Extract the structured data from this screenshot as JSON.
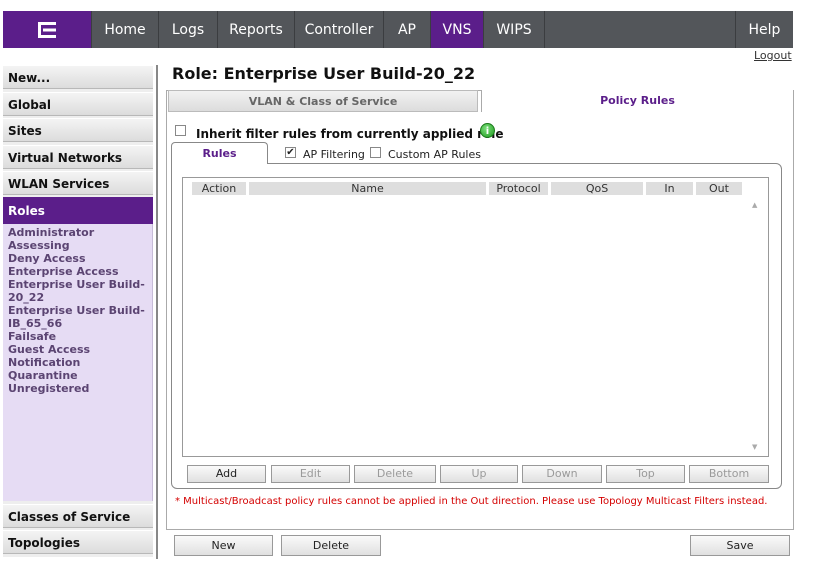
{
  "nav": {
    "tabs": [
      {
        "label": "Home"
      },
      {
        "label": "Logs"
      },
      {
        "label": "Reports"
      },
      {
        "label": "Controller"
      },
      {
        "label": "AP"
      },
      {
        "label": "VNS"
      },
      {
        "label": "WIPS"
      }
    ],
    "active_tab": "VNS",
    "help_label": "Help",
    "logout_label": "Logout",
    "accent_color": "#5b1e8a",
    "bar_color": "#53565a"
  },
  "sidebar": {
    "top_items": [
      "New...",
      "Global",
      "Sites",
      "Virtual Networks",
      "WLAN Services",
      "Roles"
    ],
    "active_item": "Roles",
    "roles": [
      "Administrator",
      "Assessing",
      "Deny Access",
      "Enterprise Access",
      "Enterprise User Build-",
      "20_22",
      "Enterprise User Build-",
      "IB_65_66",
      "Failsafe",
      "Guest Access",
      "Notification",
      "Quarantine",
      "Unregistered"
    ],
    "bottom_items": [
      "Classes of Service",
      "Topologies"
    ]
  },
  "main": {
    "title": "Role: Enterprise User Build-20_22",
    "tabs": [
      {
        "label": "VLAN & Class of Service",
        "active": false
      },
      {
        "label": "Policy Rules",
        "active": true
      }
    ],
    "inherit_label": "Inherit filter rules from currently applied role",
    "inherit_checked": false,
    "subtab_label": "Rules",
    "ap_filtering_label": "AP Filtering",
    "ap_filtering_checked": true,
    "custom_ap_rules_label": "Custom AP Rules",
    "custom_ap_rules_checked": false,
    "table": {
      "columns": [
        "Action",
        "Name",
        "Protocol",
        "QoS",
        "In",
        "Out"
      ],
      "rows": []
    },
    "rule_buttons": [
      {
        "label": "Add",
        "enabled": true
      },
      {
        "label": "Edit",
        "enabled": false
      },
      {
        "label": "Delete",
        "enabled": false
      },
      {
        "label": "Up",
        "enabled": false
      },
      {
        "label": "Down",
        "enabled": false
      },
      {
        "label": "Top",
        "enabled": false
      },
      {
        "label": "Bottom",
        "enabled": false
      }
    ],
    "note": "* Multicast/Broadcast policy rules cannot be applied in the Out direction. Please use Topology Multicast Filters instead.",
    "footer": {
      "new_label": "New",
      "delete_label": "Delete",
      "save_label": "Save"
    }
  }
}
